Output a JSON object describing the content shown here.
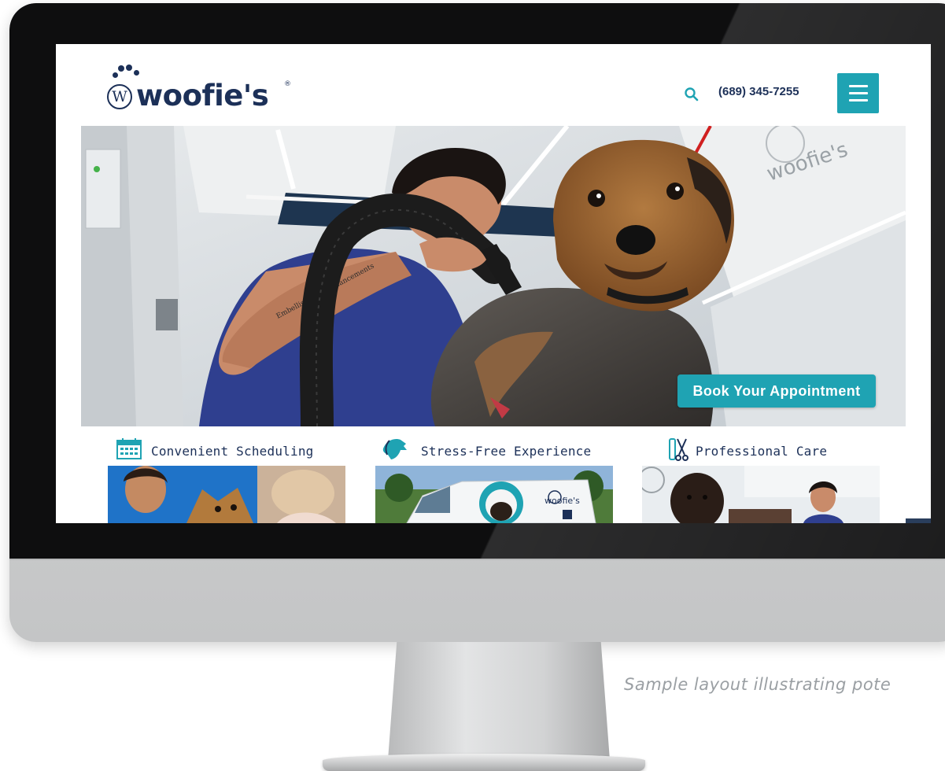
{
  "site": {
    "brand": "woofie's",
    "logo_letter": "W",
    "phone": "(689) 345-7255",
    "book_label": "Book Your Appointment",
    "hero_tattoo": "Embellish Your Enhancements",
    "hero_wall_logo": "woofie's"
  },
  "features": [
    {
      "title": "Convenient Scheduling",
      "icon": "calendar-icon"
    },
    {
      "title": "Stress-Free Experience",
      "icon": "dog-head-icon"
    },
    {
      "title": "Professional Care",
      "icon": "grooming-tools-icon"
    }
  ],
  "van_brand": "woofie's",
  "caption": "Sample layout illustrating pote",
  "colors": {
    "accent": "#1fa3b3",
    "navy": "#1c3058",
    "caption": "#9a9fa3"
  }
}
